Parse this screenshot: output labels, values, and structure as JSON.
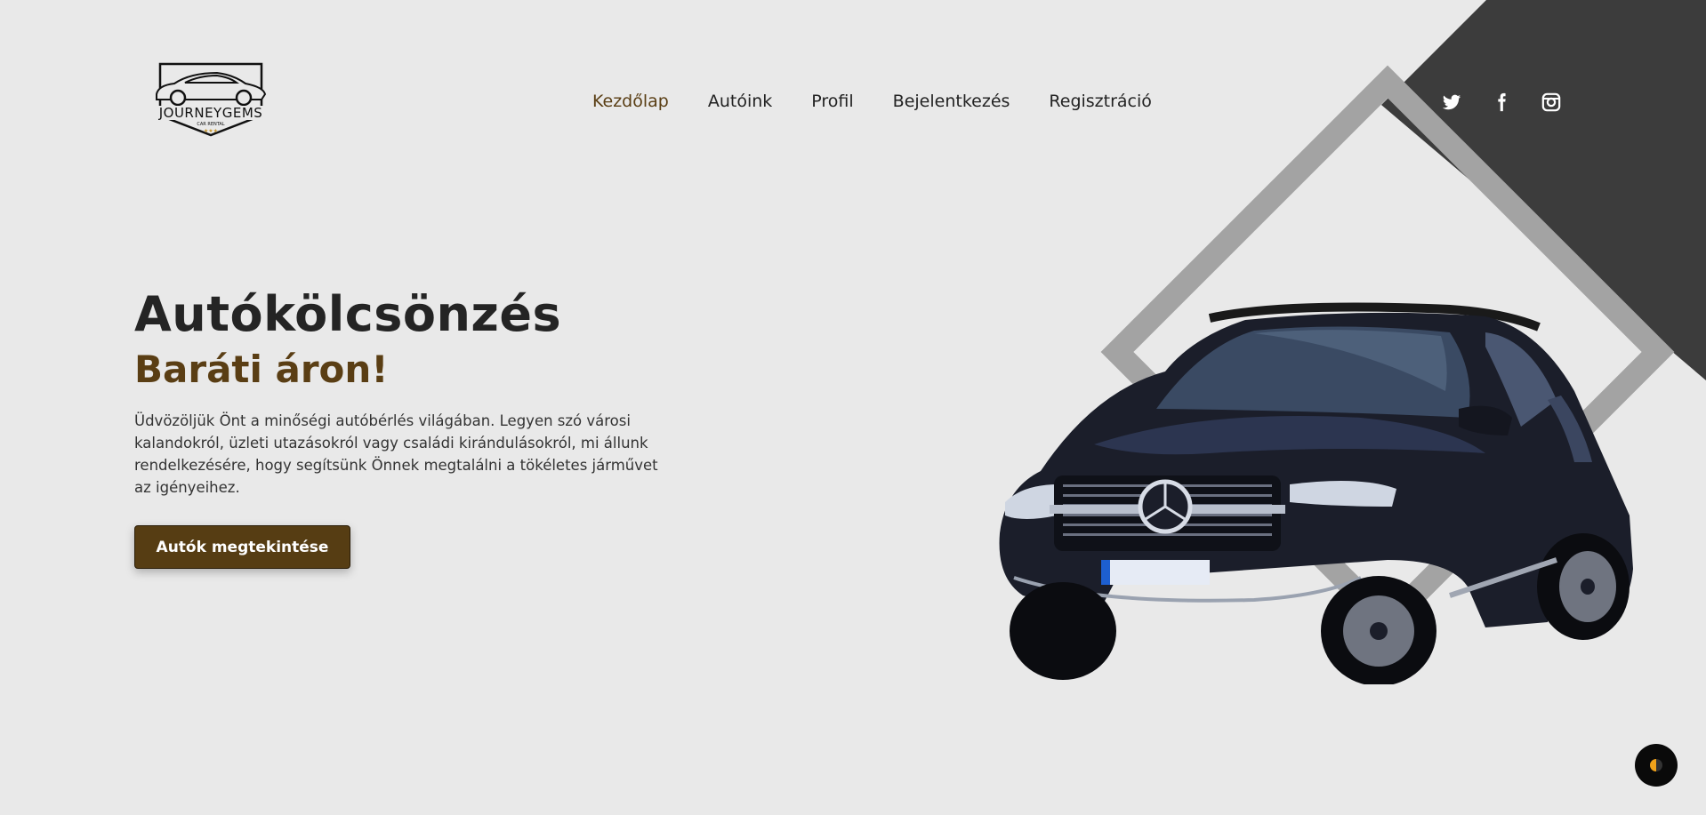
{
  "brand": {
    "logo_text": "JOURNEYGEMS",
    "logo_subtext": "CAR RENTAL"
  },
  "nav": {
    "items": [
      {
        "label": "Kezdőlap",
        "active": true
      },
      {
        "label": "Autóink",
        "active": false
      },
      {
        "label": "Profil",
        "active": false
      },
      {
        "label": "Bejelentkezés",
        "active": false
      },
      {
        "label": "Regisztráció",
        "active": false
      }
    ]
  },
  "social": {
    "icons": [
      "twitter-icon",
      "facebook-icon",
      "instagram-icon"
    ]
  },
  "hero": {
    "title": "Autókölcsönzés",
    "subtitle": "Baráti áron!",
    "description": "Üdvözöljük Önt a minőségi autóbérlés világában. Legyen szó városi kalandokról, üzleti utazásokról vagy családi kirándulásokról, mi állunk rendelkezésére, hogy segítsünk Önnek megtalálni a tökéletes járművet az igényeihez.",
    "cta_label": "Autók megtekintése"
  },
  "colors": {
    "accent": "#5a3e14",
    "dark": "#3c3c3c",
    "background": "#e9e9e9"
  },
  "theme_toggle": {
    "icon": "theme-toggle-icon"
  }
}
